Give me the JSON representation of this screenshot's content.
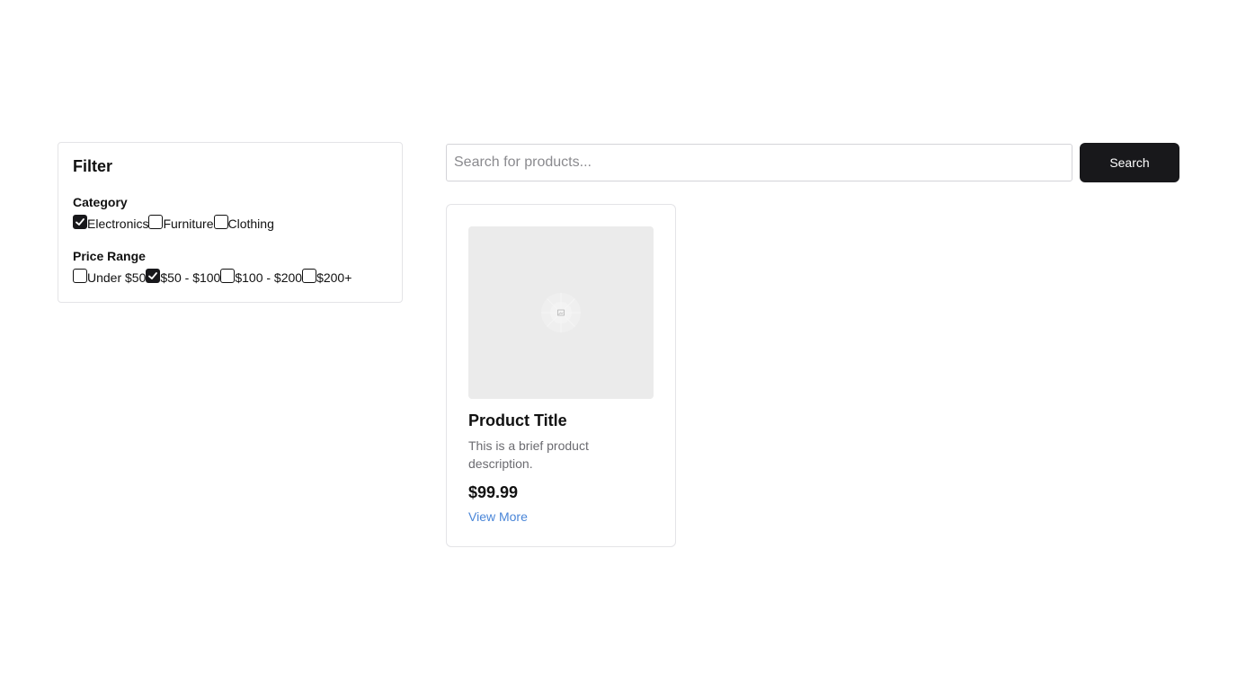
{
  "filter": {
    "title": "Filter",
    "category": {
      "title": "Category",
      "options": [
        {
          "label": "Electronics",
          "checked": true
        },
        {
          "label": "Furniture",
          "checked": false
        },
        {
          "label": "Clothing",
          "checked": false
        }
      ]
    },
    "price_range": {
      "title": "Price Range",
      "options": [
        {
          "label": "Under $50",
          "checked": false
        },
        {
          "label": "$50 - $100",
          "checked": true
        },
        {
          "label": "$100 - $200",
          "checked": false
        },
        {
          "label": "$200+",
          "checked": false
        }
      ]
    }
  },
  "search": {
    "placeholder": "Search for products...",
    "value": "",
    "button_label": "Search"
  },
  "products": [
    {
      "image_icon": "image-placeholder-icon",
      "title": "Product Title",
      "description": "This is a brief product description.",
      "price": "$99.99",
      "link_label": "View More"
    }
  ],
  "colors": {
    "accent_dark": "#18181b",
    "link": "#4a86d8",
    "muted_text": "#6b6b70",
    "border": "#e4e4e7",
    "image_bg": "#ebebeb"
  }
}
